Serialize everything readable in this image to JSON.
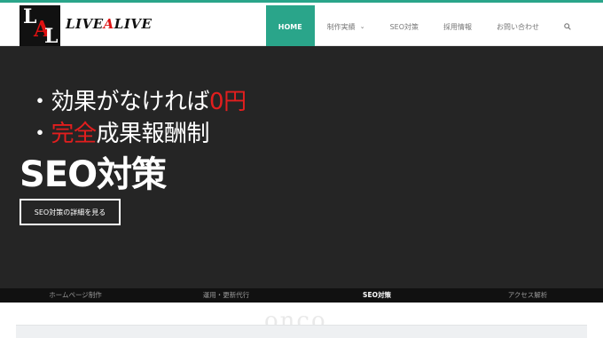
{
  "header": {
    "logo_mark": "LAL",
    "logo_text_parts": [
      "LIVE",
      "A",
      "LIVE"
    ]
  },
  "nav": {
    "items": [
      {
        "label": "HOME",
        "active": true
      },
      {
        "label": "制作実績",
        "dropdown": true
      },
      {
        "label": "SEO対策"
      },
      {
        "label": "採用情報"
      },
      {
        "label": "お問い合わせ"
      }
    ],
    "search_icon": "search-icon"
  },
  "hero": {
    "bullet1": {
      "dot": "・",
      "text": "効果がなければ",
      "highlight": "0円"
    },
    "bullet2": {
      "dot": "・",
      "highlight": "完全",
      "text": "成果報酬制"
    },
    "headline": "SEO対策",
    "cta_label": "SEO対策の詳細を見る"
  },
  "subnav": {
    "tabs": [
      {
        "label": "ホームページ制作"
      },
      {
        "label": "運用・更新代行"
      },
      {
        "label": "SEO対策",
        "current": true
      },
      {
        "label": "アクセス解析"
      }
    ]
  },
  "below": {
    "ghost_text": "onco"
  },
  "colors": {
    "accent": "#2aa58a",
    "hero_bg": "#252525",
    "highlight_red": "#e21e1e"
  }
}
